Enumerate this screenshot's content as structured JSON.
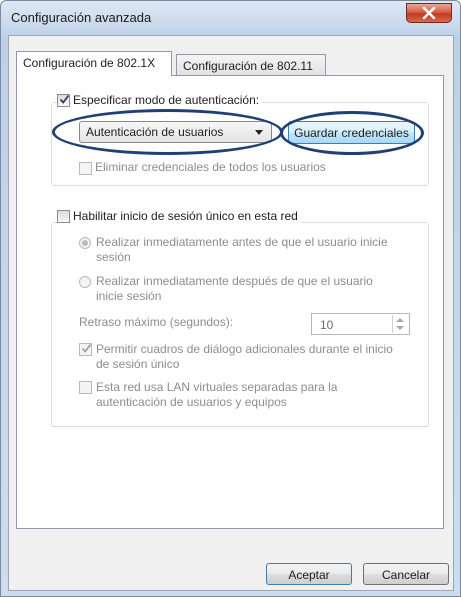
{
  "window": {
    "title": "Configuración avanzada",
    "close_icon": "close-icon"
  },
  "tabs": [
    {
      "label": "Configuración de 802.1X",
      "active": true
    },
    {
      "label": "Configuración de 802.11",
      "active": false
    }
  ],
  "auth_mode": {
    "checkbox_label": "Especificar modo de autenticación:",
    "checked": true,
    "dropdown_value": "Autenticación de usuarios",
    "save_button": "Guardar credenciales",
    "delete_label": "Eliminar credenciales de todos los usuarios",
    "delete_checked": false
  },
  "sso": {
    "checkbox_label": "Habilitar inicio de sesión único en esta red",
    "checked": false,
    "radio_before_line1": "Realizar inmediatamente antes de que el usuario inicie",
    "radio_before_line2": "sesión",
    "radio_after_line1": "Realizar inmediatamente después de que el usuario",
    "radio_after_line2": "inicie sesión",
    "delay_label": "Retraso máximo (segundos):",
    "delay_value": "10",
    "dialogs_line1": "Permitir cuadros de diálogo adicionales durante el inicio",
    "dialogs_line2": "de sesión único",
    "dialogs_checked": true,
    "vlan_line1": "Esta red usa LAN virtuales separadas para la",
    "vlan_line2": "autenticación de usuarios y equipos",
    "vlan_checked": false
  },
  "footer": {
    "accept_label": "Aceptar",
    "cancel_label": "Cancelar"
  },
  "colors": {
    "annotation_ellipse": "#1f3f77",
    "title_close": "#c2391f"
  }
}
